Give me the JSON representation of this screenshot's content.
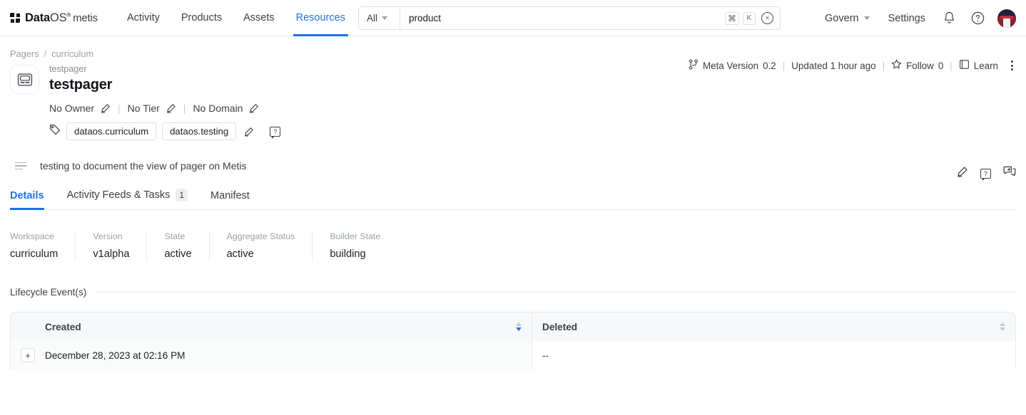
{
  "nav": {
    "brand": {
      "data": "Data",
      "os": "OS",
      "reg": "®",
      "metis": "metis"
    },
    "items": [
      {
        "label": "Activity",
        "active": false
      },
      {
        "label": "Products",
        "active": false
      },
      {
        "label": "Assets",
        "active": false
      },
      {
        "label": "Resources",
        "active": true
      }
    ],
    "right": [
      {
        "label": "Govern"
      },
      {
        "label": "Settings"
      }
    ]
  },
  "search": {
    "scope": "All",
    "value": "product",
    "placeholder": "Search",
    "kbd_cmd": "⌘",
    "kbd_key": "K",
    "clear": "×"
  },
  "breadcrumb": {
    "root": "Pagers",
    "sep": "/",
    "current": "curriculum"
  },
  "entity": {
    "sub_name": "testpager",
    "title": "testpager",
    "owner": "No Owner",
    "tier": "No Tier",
    "domain": "No Domain",
    "divider": "|",
    "tags": [
      "dataos.curriculum",
      "dataos.testing"
    ]
  },
  "meta": {
    "version_label": "Meta Version",
    "version_value": "0.2",
    "updated": "Updated 1 hour ago",
    "follow_label": "Follow",
    "follow_count": "0",
    "learn": "Learn",
    "pipe": "|"
  },
  "description": {
    "text": "testing to document the view of pager on Metis"
  },
  "tabs": [
    {
      "label": "Details",
      "badge": "",
      "active": true
    },
    {
      "label": "Activity Feeds & Tasks",
      "badge": "1",
      "active": false
    },
    {
      "label": "Manifest",
      "badge": "",
      "active": false
    }
  ],
  "fields": [
    {
      "label": "Workspace",
      "value": "curriculum"
    },
    {
      "label": "Version",
      "value": "v1alpha"
    },
    {
      "label": "State",
      "value": "active"
    },
    {
      "label": "Aggregate Status",
      "value": "active"
    },
    {
      "label": "Builder State",
      "value": "building"
    }
  ],
  "lifecycle": {
    "title": "Lifecycle Event(s)",
    "columns": [
      "Created",
      "Deleted"
    ],
    "rows": [
      {
        "expand": "+",
        "created": "December 28, 2023 at 02:16 PM",
        "deleted": "--"
      }
    ]
  },
  "colors": {
    "accent": "#1a73e8",
    "muted": "#9aa0a6",
    "border": "#e8eaed"
  }
}
